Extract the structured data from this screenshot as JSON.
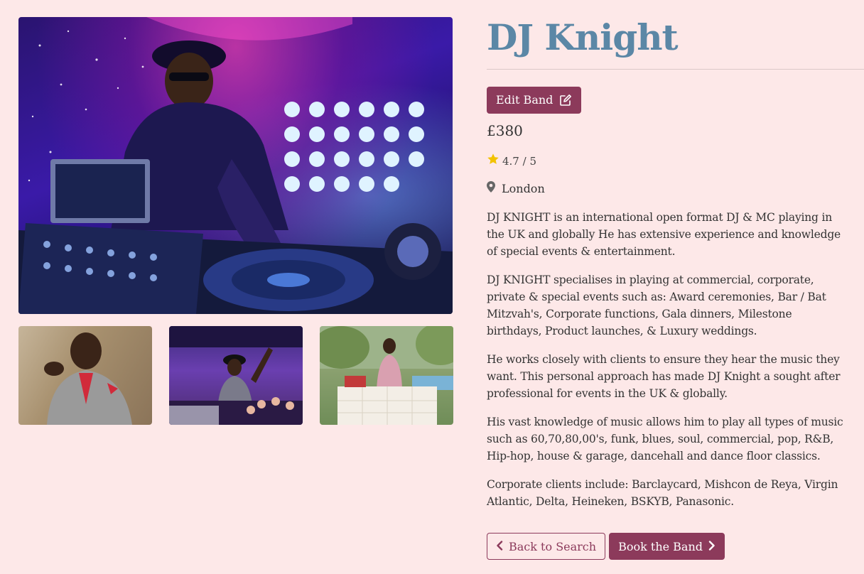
{
  "band": {
    "name": "DJ Knight",
    "price": "£380",
    "rating": "4.7 / 5",
    "location": "London"
  },
  "actions": {
    "edit_label": "Edit Band",
    "back_label": "Back to Search",
    "book_label": "Book the Band"
  },
  "description": [
    "DJ KNIGHT is an international open format DJ & MC playing in the UK and globally He has extensive experience and knowledge of special events & entertainment.",
    "DJ KNIGHT specialises in playing at commercial, corporate, private & special events such as: Award ceremonies, Bar / Bat Mitzvah's, Corporate functions, Gala dinners, Milestone birthdays, Product launches, & Luxury weddings.",
    "He works closely with clients to ensure they hear the music they want. This personal approach has made DJ Knight a sought after professional for events in the UK & globally.",
    "His vast knowledge of music allows him to play all types of music such as 60,70,80,00's, funk, blues, soul, commercial, pop, R&B, Hip-hop, house & garage, dancehall and dance floor classics.",
    "Corporate clients include: Barclaycard, Mishcon de Reya, Virgin Atlantic, Delta, Heineken, BSKYB, Panasonic."
  ],
  "icons": {
    "edit": "edit-icon",
    "star": "star-icon",
    "location": "map-marker-icon",
    "back": "chevron-left-icon",
    "book": "chevron-right-icon"
  },
  "colors": {
    "background": "#fde8e8",
    "title": "#5b87a6",
    "accent": "#8c3a5b",
    "star": "#f2c200"
  }
}
